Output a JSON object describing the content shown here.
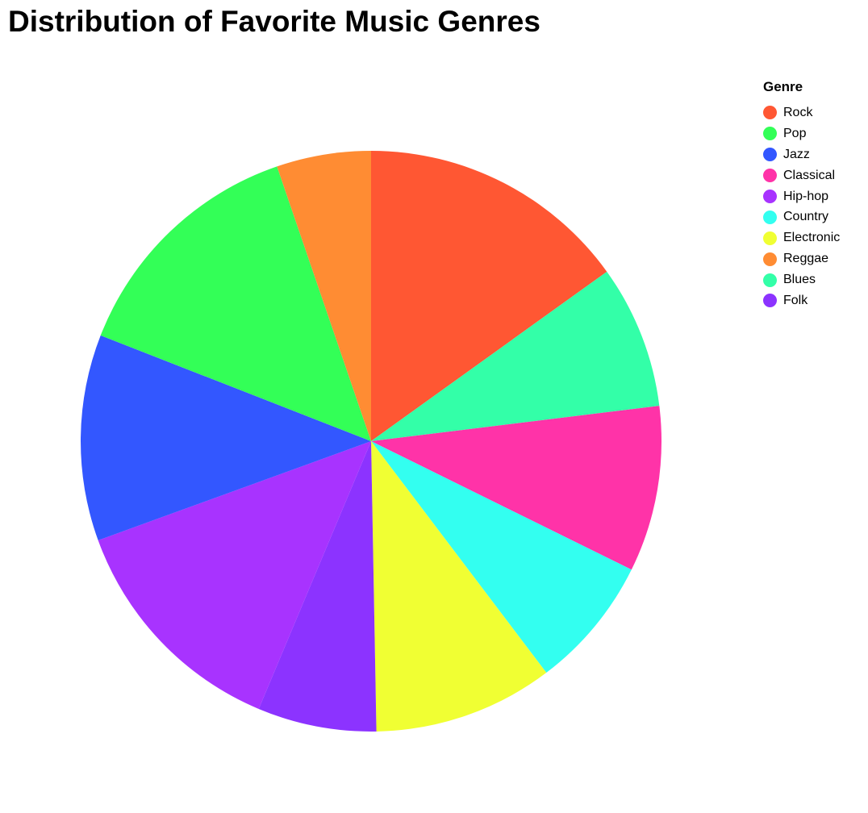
{
  "chart_data": {
    "type": "pie",
    "title": "Distribution of Favorite Music Genres",
    "legend_title": "Genre",
    "legend_position": "top-right",
    "categories": [
      "Rock",
      "Pop",
      "Jazz",
      "Classical",
      "Hip-hop",
      "Country",
      "Electronic",
      "Reggae",
      "Blues",
      "Folk"
    ],
    "values": [
      15.5,
      14.2,
      11.8,
      9.5,
      13.5,
      7.6,
      10.3,
      5.4,
      8.2,
      6.8
    ],
    "colors": [
      "#ff5733",
      "#33ff57",
      "#3357ff",
      "#ff33a8",
      "#a833ff",
      "#33fff0",
      "#f0ff33",
      "#ff8c33",
      "#33ffa8",
      "#8c33ff"
    ],
    "drawing_order": [
      "Rock",
      "Blues",
      "Classical",
      "Country",
      "Electronic",
      "Folk",
      "Hip-hop",
      "Jazz",
      "Pop",
      "Reggae"
    ]
  }
}
